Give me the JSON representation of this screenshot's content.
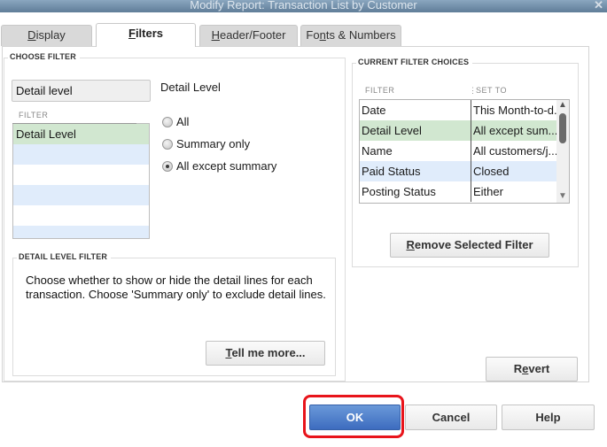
{
  "window": {
    "title": "Modify Report: Transaction List by Customer",
    "close_icon": "close-x-icon"
  },
  "tabs": [
    {
      "label_prefix": "",
      "accel": "D",
      "label_rest": "isplay",
      "active": false
    },
    {
      "label_prefix": "",
      "accel": "F",
      "label_rest": "ilters",
      "active": true
    },
    {
      "label_prefix": "",
      "accel": "H",
      "label_rest": "eader/Footer",
      "active": false
    },
    {
      "label_prefix": "Fo",
      "accel": "n",
      "label_rest": "ts & Numbers",
      "active": false
    }
  ],
  "choose_filter": {
    "group_label": "CHOOSE FILTER",
    "search_value": "Detail level",
    "list_header": "FILTER",
    "list_items": [
      "Detail Level",
      "",
      "",
      "",
      "",
      ""
    ],
    "selected_title": "Detail Level",
    "options": [
      {
        "label": "All",
        "checked": false
      },
      {
        "label": "Summary only",
        "checked": false
      },
      {
        "label": "All except summary",
        "checked": true
      }
    ]
  },
  "detail_level_filter": {
    "group_label": "DETAIL LEVEL FILTER",
    "description": "Choose whether to show or hide the detail lines for each transaction. Choose 'Summary only' to exclude detail lines.",
    "tell_me_more_accel": "T",
    "tell_me_more_rest": "ell me more..."
  },
  "current_filters": {
    "group_label": "CURRENT FILTER CHOICES",
    "col_filter": "FILTER",
    "col_set_to": "SET TO",
    "rows": [
      {
        "filter": "Date",
        "set_to": "This Month-to-d..."
      },
      {
        "filter": "Detail Level",
        "set_to": "All except sum..."
      },
      {
        "filter": "Name",
        "set_to": "All customers/j..."
      },
      {
        "filter": "Paid Status",
        "set_to": "Closed"
      },
      {
        "filter": "Posting Status",
        "set_to": "Either"
      }
    ],
    "remove_accel": "R",
    "remove_rest": "emove Selected Filter"
  },
  "revert": {
    "prefix": "R",
    "accel": "e",
    "rest": "vert"
  },
  "footer": {
    "ok_label": "OK",
    "cancel_label": "Cancel",
    "help_label": "Help",
    "highlight_color": "#e8141b"
  }
}
